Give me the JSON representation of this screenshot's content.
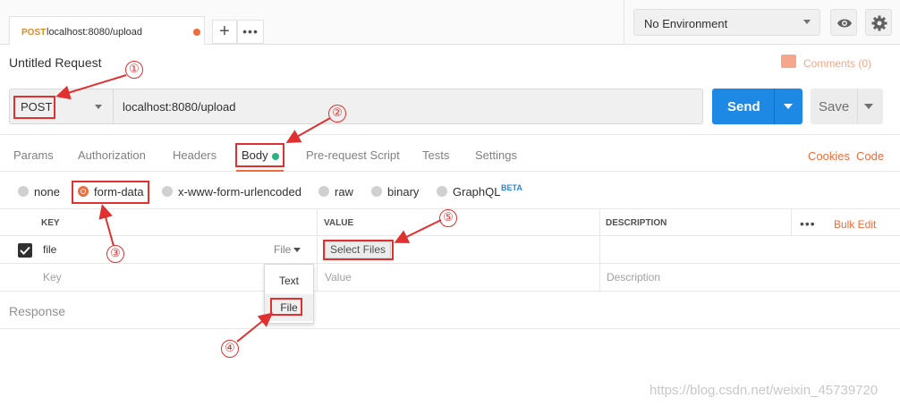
{
  "tab": {
    "method": "POST",
    "url": "localhost:8080/upload"
  },
  "environment": {
    "label": "No Environment"
  },
  "request": {
    "title": "Untitled Request",
    "comments": "Comments (0)",
    "method": "POST",
    "url": "localhost:8080/upload",
    "send_label": "Send",
    "save_label": "Save"
  },
  "subtabs": [
    "Params",
    "Authorization",
    "Headers",
    "Body",
    "Pre-request Script",
    "Tests",
    "Settings"
  ],
  "links": {
    "cookies": "Cookies",
    "code": "Code"
  },
  "body_types": [
    "none",
    "form-data",
    "x-www-form-urlencoded",
    "raw",
    "binary",
    "GraphQL"
  ],
  "body_types_selected": "form-data",
  "beta": "BETA",
  "table": {
    "headers": {
      "key": "KEY",
      "value": "VALUE",
      "description": "DESCRIPTION"
    },
    "bulk_edit": "Bulk Edit",
    "row": {
      "key": "file",
      "type": "File",
      "value_button": "Select Files",
      "checked": true
    },
    "placeholders": {
      "key": "Key",
      "value": "Value",
      "description": "Description"
    }
  },
  "type_dropdown": {
    "options": [
      "Text",
      "File"
    ],
    "highlighted": "File"
  },
  "response": {
    "label": "Response"
  },
  "annotations": [
    "①",
    "②",
    "③",
    "④",
    "⑤"
  ],
  "watermark": "https://blog.csdn.net/weixin_45739720",
  "colors": {
    "accent": "#f26b3a",
    "send": "#1e88e5",
    "annotation": "#e03030",
    "body_indicator": "#26b47f"
  }
}
